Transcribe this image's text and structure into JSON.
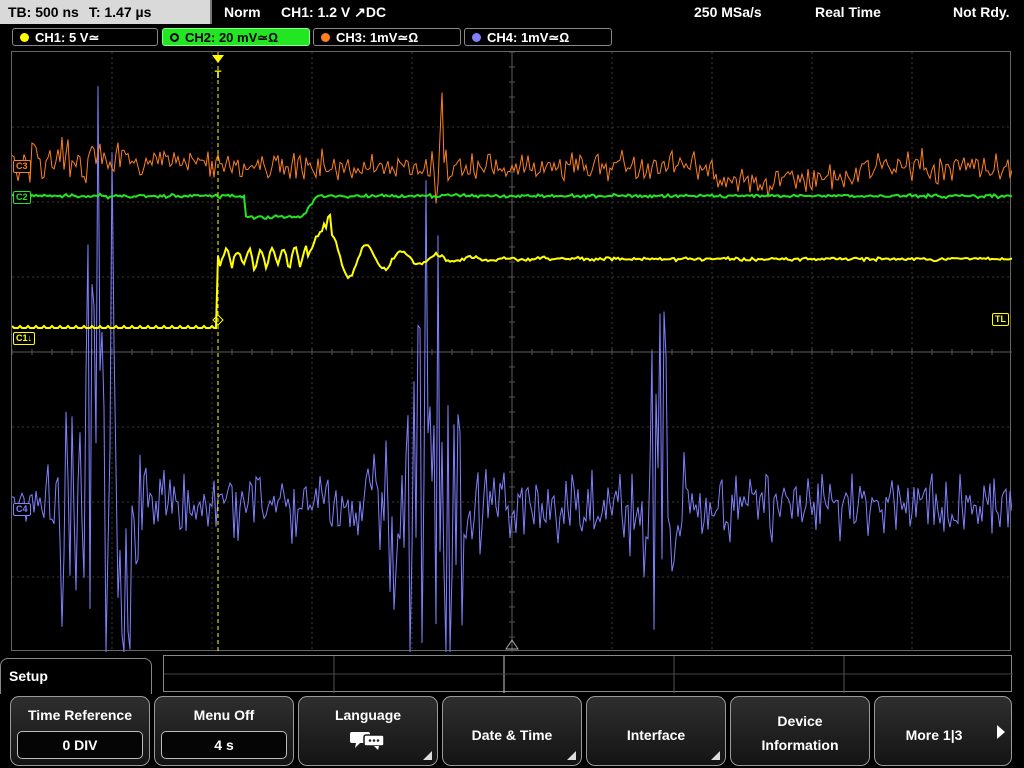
{
  "status": {
    "timebase": "TB: 500 ns",
    "time_pos": "T: 1.47 µs",
    "mode": "Norm",
    "trigger": "CH1: 1.2 V ↗DC",
    "sample_rate": "250 MSa/s",
    "acq_mode": "Real Time",
    "ready": "Not Rdy."
  },
  "channels": [
    {
      "label": "CH1: 5 V≃",
      "color": "#ffff00"
    },
    {
      "label": "CH2: 20 mV≃Ω",
      "color": "#00e000"
    },
    {
      "label": "CH3: 1mV≃Ω",
      "color": "#ff8020"
    },
    {
      "label": "CH4: 1mV≃Ω",
      "color": "#8080ff"
    }
  ],
  "markers": {
    "ch1": "C1↓",
    "ch2": "C2",
    "ch3": "C3",
    "ch4": "C4",
    "trigger_level": "TL",
    "trigger_pos": "T"
  },
  "menu": {
    "title": "Setup",
    "time_reference": {
      "label": "Time Reference",
      "value": "0 DIV"
    },
    "menu_off": {
      "label": "Menu Off",
      "value": "4 s"
    },
    "language": {
      "label": "Language"
    },
    "date_time": {
      "label": "Date & Time"
    },
    "interface": {
      "label": "Interface"
    },
    "device_information": {
      "label": "Device",
      "label2": "Information"
    },
    "more": {
      "label": "More 1|3"
    }
  },
  "icons": [
    "speech-bubbles-icon",
    "arrow-right-icon",
    "submenu-corner-icon",
    "trigger-marker-icon"
  ]
}
